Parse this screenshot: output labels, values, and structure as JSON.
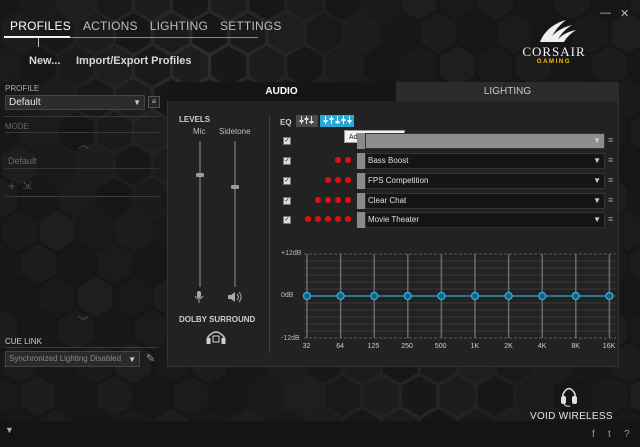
{
  "nav": {
    "items": [
      "PROFILES",
      "ACTIONS",
      "LIGHTING",
      "SETTINGS"
    ]
  },
  "toplinks": {
    "new": "New...",
    "import_export": "Import/Export Profiles"
  },
  "window": {
    "minimize": "—",
    "close": "✕"
  },
  "logo": {
    "word": "CORSAIR",
    "sub": "GAMING"
  },
  "left": {
    "profile_label": "PROFILE",
    "profile_value": "Default",
    "mode_label": "MODE",
    "mode_value": "Default",
    "cue_link_label": "CUE LINK",
    "cue_link_value": "Synchronized Lighting Disabled"
  },
  "tabs": {
    "audio": "AUDIO",
    "lighting": "LIGHTING"
  },
  "levels": {
    "title": "LEVELS",
    "mic": "Mic",
    "sidetone": "Sidetone",
    "mic_level": 0.78,
    "sidetone_level": 0.7
  },
  "dolby": {
    "label": "DOLBY SURROUND"
  },
  "eq": {
    "label": "EQ",
    "tooltip": "Advanced mode",
    "presets": [
      {
        "name": "",
        "dots": 0,
        "checked": true
      },
      {
        "name": "Bass Boost",
        "dots": 2,
        "checked": true
      },
      {
        "name": "FPS Competition",
        "dots": 3,
        "checked": true
      },
      {
        "name": "Clear Chat",
        "dots": 4,
        "checked": true
      },
      {
        "name": "Movie Theater",
        "dots": 5,
        "checked": true
      }
    ],
    "db_labels": {
      "top": "+12dB",
      "mid": "0dB",
      "bottom": "-12dB"
    },
    "bands": [
      "32",
      "64",
      "125",
      "250",
      "500",
      "1K",
      "2K",
      "4K",
      "8K",
      "16K"
    ],
    "band_values_db": [
      0,
      0,
      0,
      0,
      0,
      0,
      0,
      0,
      0,
      0
    ],
    "accent": "#29a8d8"
  },
  "device": {
    "name": "VOID WIRELESS"
  },
  "social": {
    "facebook": "f",
    "twitter": "t",
    "help": "?"
  },
  "colors": {
    "accent": "#29a8d8",
    "preset_dot": "#e01010",
    "logo_sub": "#f2c200"
  }
}
